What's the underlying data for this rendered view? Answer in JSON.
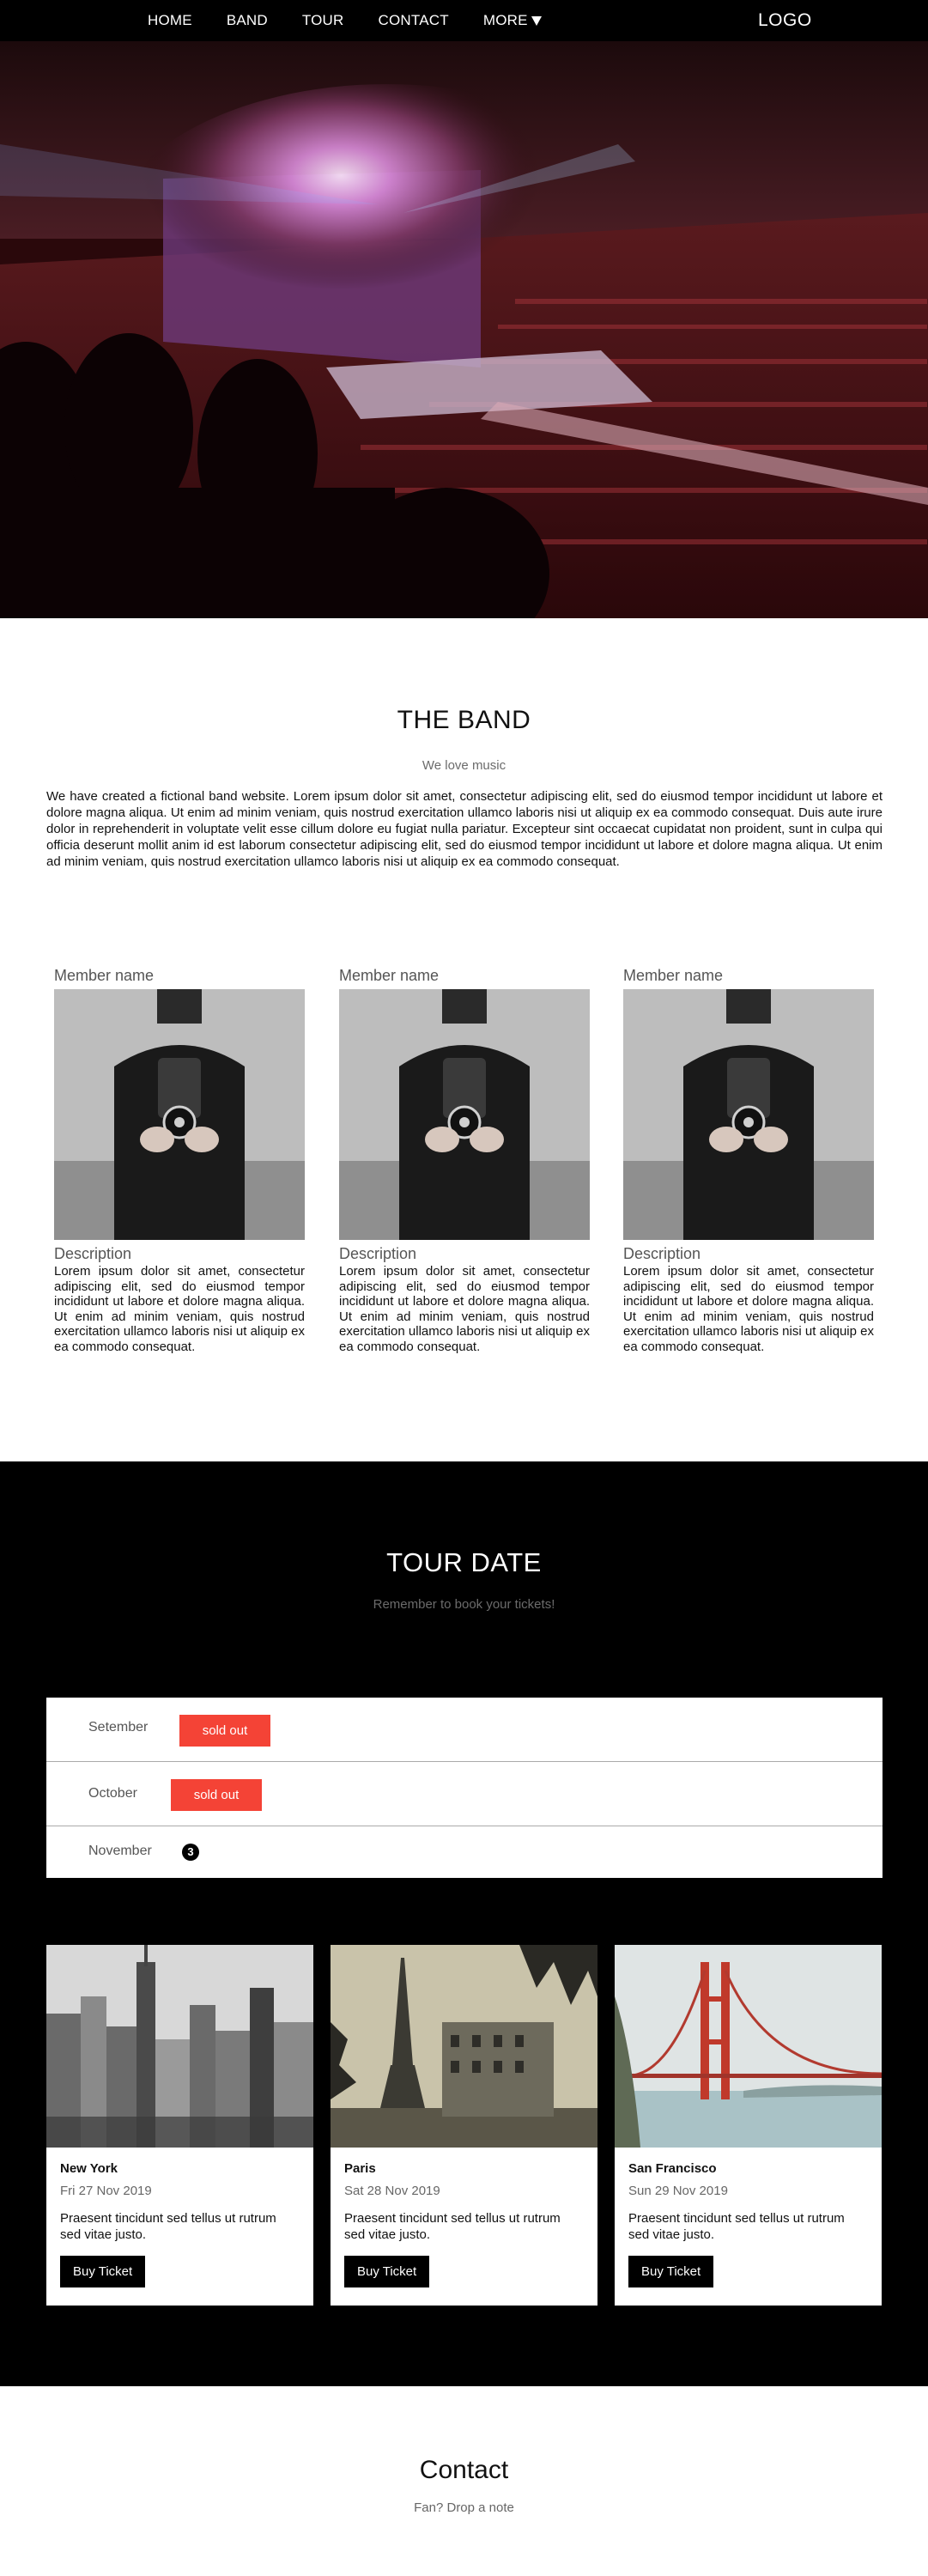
{
  "nav": {
    "links": [
      "HOME",
      "BAND",
      "TOUR",
      "CONTACT"
    ],
    "more_label": "MORE",
    "logo": "LOGO"
  },
  "band": {
    "title": "THE BAND",
    "subtitle": "We love music",
    "text": "We have created a fictional band website. Lorem ipsum dolor sit amet, consectetur adipiscing elit, sed do eiusmod tempor incididunt ut labore et dolore magna aliqua. Ut enim ad minim veniam, quis nostrud exercitation ullamco laboris nisi ut aliquip ex ea commodo consequat. Duis aute irure dolor in reprehenderit in voluptate velit esse cillum dolore eu fugiat nulla pariatur. Excepteur sint occaecat cupidatat non proident, sunt in culpa qui officia deserunt mollit anim id est laborum consectetur adipiscing elit, sed do eiusmod tempor incididunt ut labore et dolore magna aliqua. Ut enim ad minim veniam, quis nostrud exercitation ullamco laboris nisi ut aliquip ex ea commodo consequat.",
    "members": [
      {
        "name": "Member name",
        "desc_title": "Description",
        "desc": "Lorem ipsum dolor sit amet, consectetur adipiscing elit, sed do eiusmod tempor incididunt ut labore et dolore magna aliqua. Ut enim ad minim veniam, quis nostrud exercitation ullamco laboris nisi ut aliquip ex ea commodo consequat."
      },
      {
        "name": "Member name",
        "desc_title": "Description",
        "desc": "Lorem ipsum dolor sit amet, consectetur adipiscing elit, sed do eiusmod tempor incididunt ut labore et dolore magna aliqua. Ut enim ad minim veniam, quis nostrud exercitation ullamco laboris nisi ut aliquip ex ea commodo consequat."
      },
      {
        "name": "Member name",
        "desc_title": "Description",
        "desc": "Lorem ipsum dolor sit amet, consectetur adipiscing elit, sed do eiusmod tempor incididunt ut labore et dolore magna aliqua. Ut enim ad minim veniam, quis nostrud exercitation ullamco laboris nisi ut aliquip ex ea commodo consequat."
      }
    ]
  },
  "tour": {
    "title": "TOUR DATE",
    "subtitle": "Remember to book your tickets!",
    "months": [
      {
        "name": "Setember",
        "status": "sold out"
      },
      {
        "name": "October",
        "status": "sold out"
      },
      {
        "name": "November",
        "count": "3"
      }
    ],
    "cards": [
      {
        "city": "New York",
        "date": "Fri 27 Nov 2019",
        "text": "Praesent tincidunt sed tellus ut rutrum sed vitae justo.",
        "button": "Buy Ticket"
      },
      {
        "city": "Paris",
        "date": "Sat 28 Nov 2019",
        "text": "Praesent tincidunt sed tellus ut rutrum sed vitae justo.",
        "button": "Buy Ticket"
      },
      {
        "city": "San Francisco",
        "date": "Sun 29 Nov 2019",
        "text": "Praesent tincidunt sed tellus ut rutrum sed vitae justo.",
        "button": "Buy Ticket"
      }
    ],
    "colors": {
      "sold_out": "#f44336",
      "background": "#000000"
    }
  },
  "contact": {
    "title": "Contact",
    "subtitle": "Fan? Drop a note"
  }
}
